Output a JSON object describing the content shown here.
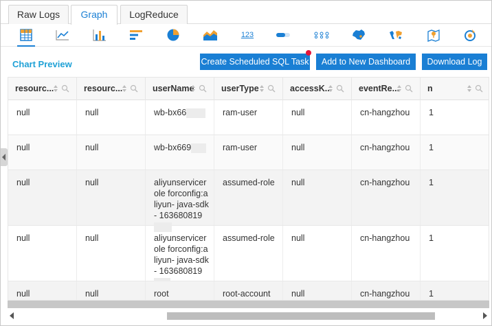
{
  "tabs": [
    {
      "label": "Raw Logs",
      "active": false
    },
    {
      "label": "Graph",
      "active": true
    },
    {
      "label": "LogReduce",
      "active": false
    }
  ],
  "chart_types": [
    {
      "icon": "table-icon",
      "active": true
    },
    {
      "icon": "line-chart-icon",
      "active": false
    },
    {
      "icon": "bar-chart-icon",
      "active": false
    },
    {
      "icon": "horizontal-bar-icon",
      "active": false
    },
    {
      "icon": "pie-chart-icon",
      "active": false
    },
    {
      "icon": "area-chart-icon",
      "active": false
    },
    {
      "icon": "single-value-icon",
      "active": false
    },
    {
      "icon": "progress-bar-icon",
      "active": false
    },
    {
      "icon": "flow-chart-icon",
      "active": false
    },
    {
      "icon": "china-map-icon",
      "active": false
    },
    {
      "icon": "world-map-icon",
      "active": false
    },
    {
      "icon": "map-pin-icon",
      "active": false
    },
    {
      "icon": "tree-map-icon",
      "active": false
    }
  ],
  "chart_type_single_value_text": "123",
  "toolbar": {
    "chart_preview": "Chart Preview",
    "create_sql_task": "Create Scheduled SQL Task",
    "add_dashboard": "Add to New Dashboard",
    "download_log": "Download Log"
  },
  "colors": {
    "accent": "#1a7fd4",
    "preview_title": "#1fa1d6",
    "notification_dot": "#e4163b"
  },
  "table": {
    "columns": [
      "resourc...",
      "resourc...",
      "userName",
      "userType",
      "accessK...",
      "eventRe...",
      "n"
    ],
    "rows": [
      [
        "null",
        "null",
        "wb-bx66",
        "ram-user",
        "null",
        "cn-hangzhou",
        "1"
      ],
      [
        "null",
        "null",
        "wb-bx669",
        "ram-user",
        "null",
        "cn-hangzhou",
        "1"
      ],
      [
        "null",
        "null",
        "aliyunservicerole forconfig:aliyun- java-sdk- 163680819",
        "assumed-role",
        "null",
        "cn-hangzhou",
        "1"
      ],
      [
        "null",
        "null",
        "aliyunservicerole forconfig:aliyun- java-sdk- 163680819",
        "assumed-role",
        "null",
        "cn-hangzhou",
        "1"
      ],
      [
        "null",
        "null",
        "root",
        "root-account",
        "null",
        "cn-hangzhou",
        "1"
      ]
    ]
  }
}
